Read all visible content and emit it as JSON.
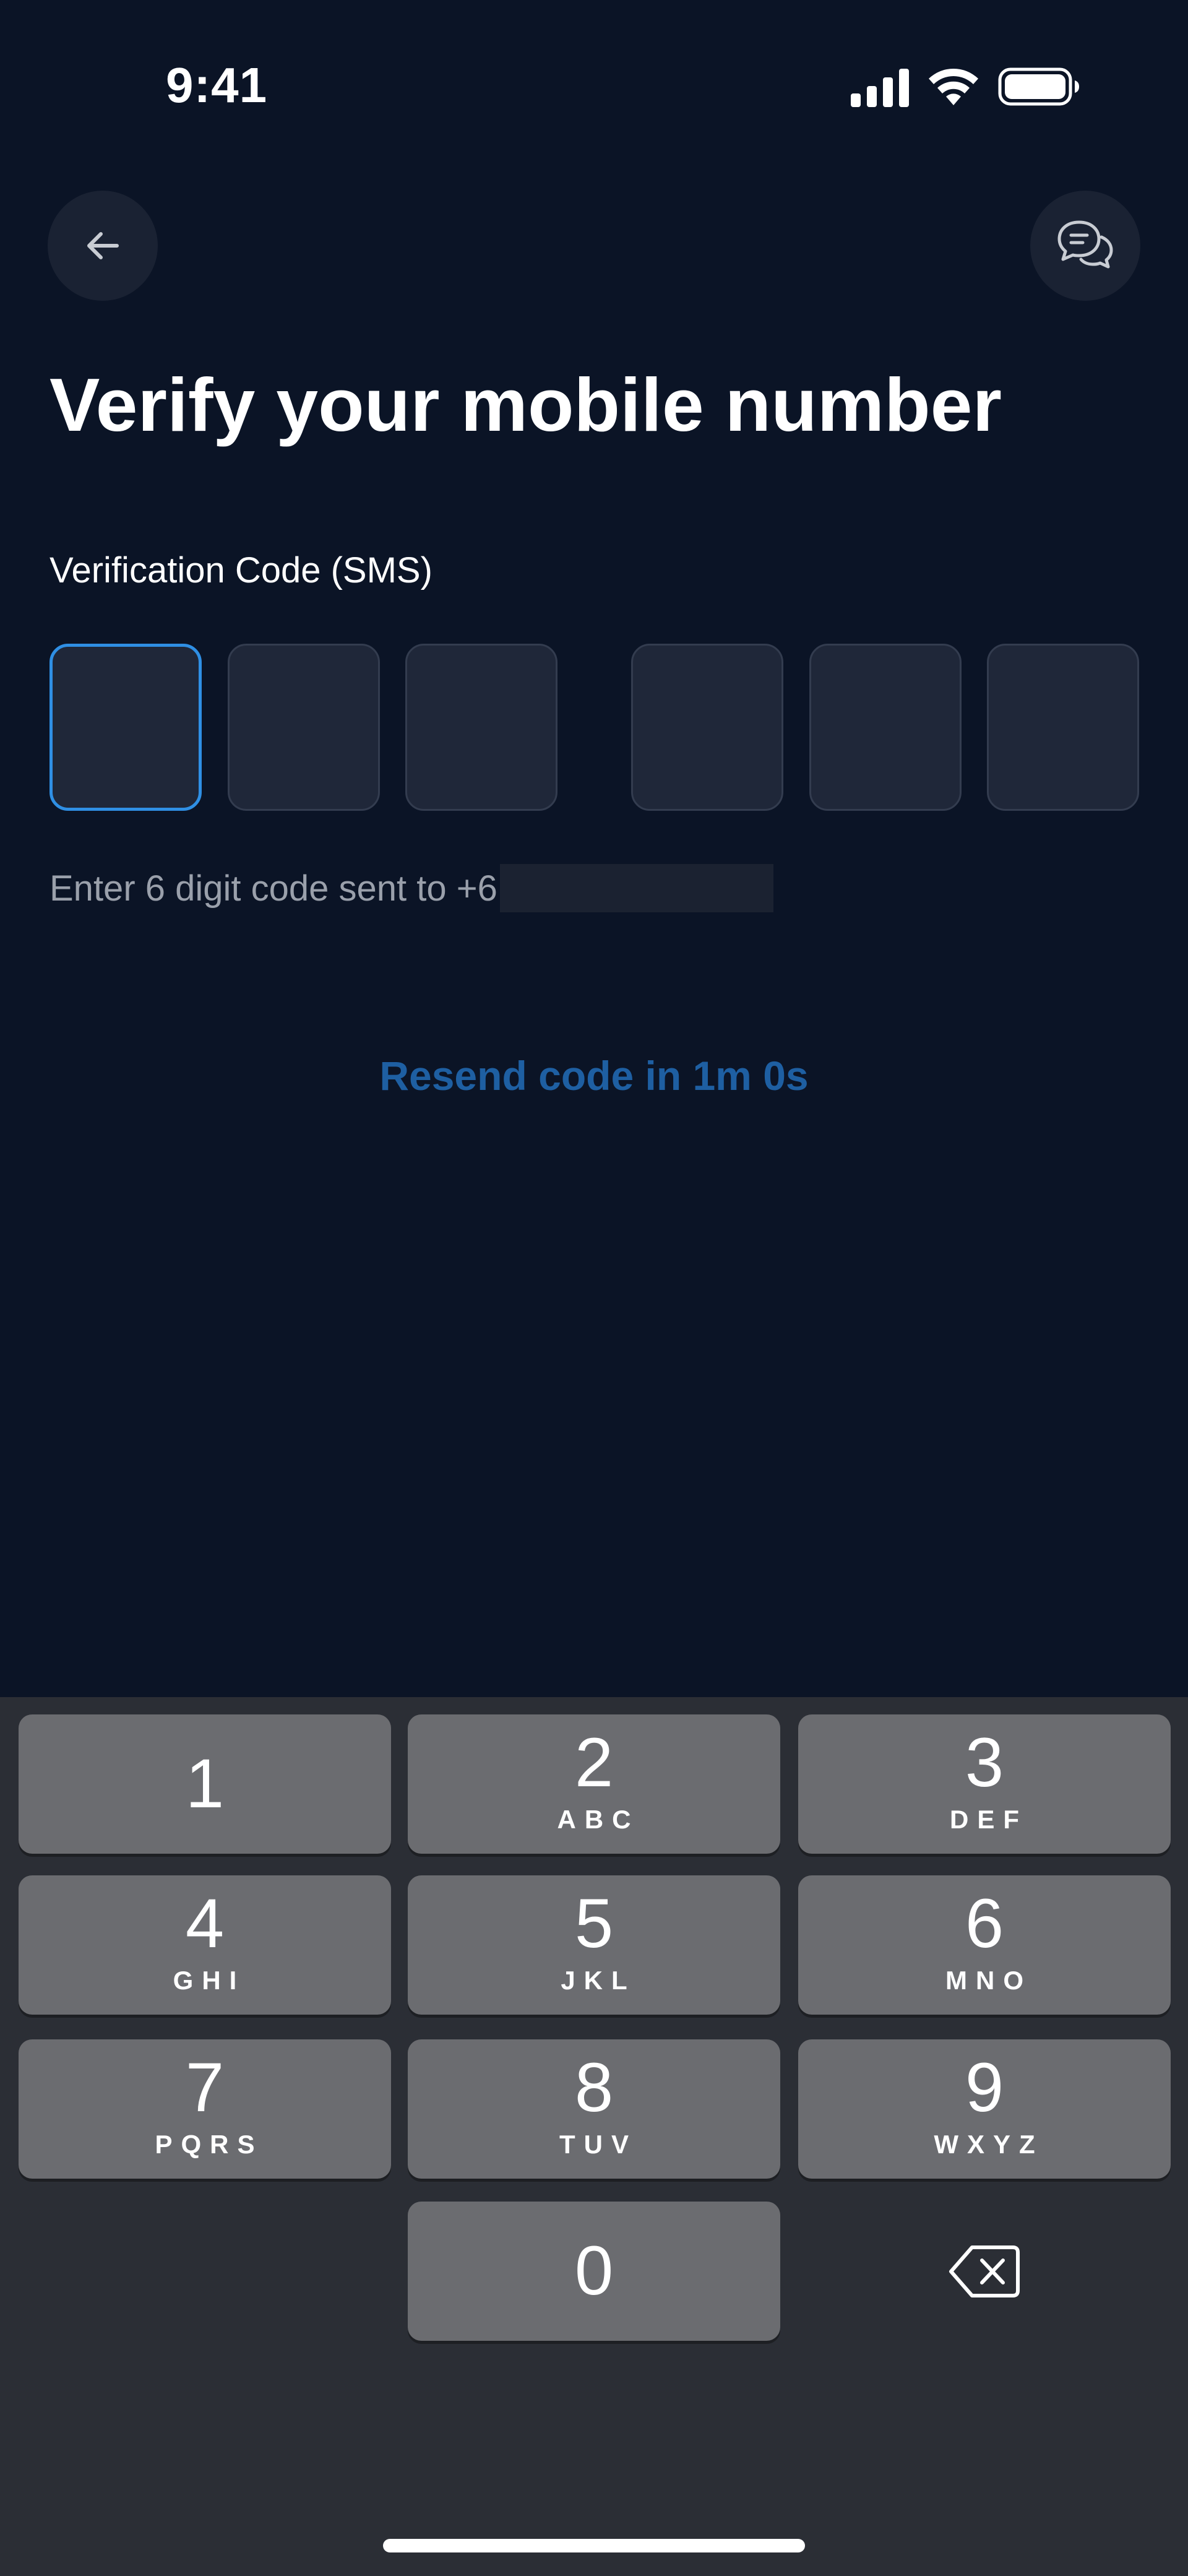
{
  "status_bar": {
    "time": "9:41",
    "icons": [
      "signal-icon",
      "wifi-icon",
      "battery-icon"
    ]
  },
  "header": {
    "back_icon": "arrow-left-icon",
    "support_icon": "chat-bubbles-icon"
  },
  "title": "Verify your mobile number",
  "otp": {
    "label": "Verification Code (SMS)",
    "digit_count": 6,
    "values": [
      "",
      "",
      "",
      "",
      "",
      ""
    ],
    "active_index": 0,
    "hint_prefix": "Enter 6 digit code sent to +6"
  },
  "resend": {
    "text": "Resend code in 1m 0s"
  },
  "keyboard": {
    "keys": [
      {
        "digit": "1",
        "letters": ""
      },
      {
        "digit": "2",
        "letters": "ABC"
      },
      {
        "digit": "3",
        "letters": "DEF"
      },
      {
        "digit": "4",
        "letters": "GHI"
      },
      {
        "digit": "5",
        "letters": "JKL"
      },
      {
        "digit": "6",
        "letters": "MNO"
      },
      {
        "digit": "7",
        "letters": "PQRS"
      },
      {
        "digit": "8",
        "letters": "TUV"
      },
      {
        "digit": "9",
        "letters": "WXYZ"
      },
      {
        "digit": "0",
        "letters": ""
      }
    ],
    "delete_icon": "backspace-icon"
  },
  "colors": {
    "background": "#0b1426",
    "accent": "#2f8fe4",
    "resend": "#1e5fa2",
    "keyboard_bg": "#2b2e35",
    "key_bg": "#6b6c70"
  }
}
